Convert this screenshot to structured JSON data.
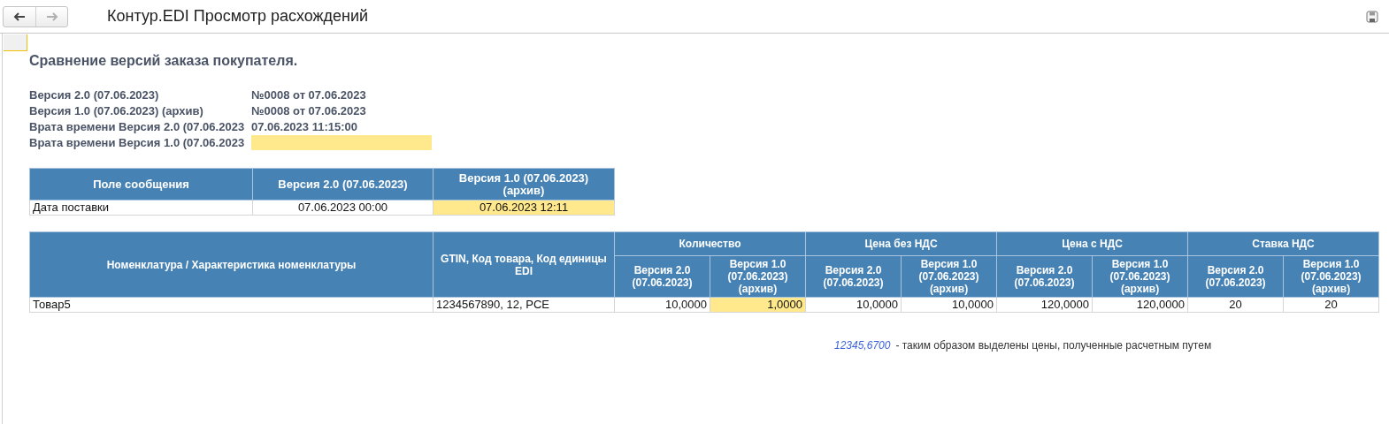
{
  "window": {
    "title": "Контур.EDI Просмотр расхождений",
    "back": {
      "disabled": false
    },
    "forward": {
      "disabled": true
    }
  },
  "report": {
    "heading": "Сравнение версий заказа покупателя.",
    "info": [
      {
        "label": "Версия 2.0 (07.06.2023)",
        "value": "№0008 от 07.06.2023",
        "highlighted": false
      },
      {
        "label": "Версия 1.0 (07.06.2023) (архив)",
        "value": "№0008 от 07.06.2023",
        "highlighted": false
      },
      {
        "label": "Врата времени Версия 2.0 (07.06.2023",
        "value": "07.06.2023 11:15:00",
        "highlighted": false
      },
      {
        "label": "Врата времени Версия 1.0 (07.06.2023",
        "highlighted": true
      }
    ],
    "fields_table": {
      "columns": [
        "Поле сообщения",
        "Версия 2.0 (07.06.2023)",
        "Версия 1.0 (07.06.2023) (архив)"
      ],
      "rows": [
        {
          "cells": [
            {
              "text": "Дата поставки",
              "highlighted": false
            },
            {
              "text": "07.06.2023 00:00",
              "highlighted": false
            },
            {
              "text": "07.06.2023 12:11",
              "highlighted": true
            }
          ]
        }
      ]
    },
    "items_table": {
      "header_rows": [
        [
          {
            "text": "Номенклатура / Характеристика номенклатуры",
            "rowspan": 2
          },
          {
            "text": "GTIN, Код товара, Код единицы EDI",
            "rowspan": 2
          },
          {
            "text": "Количество",
            "colspan": 2
          },
          {
            "text": "Цена без НДС",
            "colspan": 2
          },
          {
            "text": "Цена с НДС",
            "colspan": 2
          },
          {
            "text": "Ставка НДС",
            "colspan": 2
          }
        ],
        [
          {
            "text": "Версия 2.0 (07.06.2023)"
          },
          {
            "text": "Версия 1.0 (07.06.2023) (архив)"
          },
          {
            "text": "Версия 2.0 (07.06.2023)"
          },
          {
            "text": "Версия 1.0 (07.06.2023) (архив)"
          },
          {
            "text": "Версия 2.0 (07.06.2023)"
          },
          {
            "text": "Версия 1.0 (07.06.2023) (архив)"
          },
          {
            "text": "Версия 2.0 (07.06.2023)"
          },
          {
            "text": "Версия 1.0 (07.06.2023) (архив)"
          }
        ]
      ],
      "rows": [
        {
          "cells": [
            {
              "text": "Товар5",
              "highlighted": false
            },
            {
              "text": "1234567890, 12, PCE",
              "highlighted": false
            },
            {
              "text": "10,0000",
              "highlighted": false
            },
            {
              "text": "1,0000",
              "highlighted": true
            },
            {
              "text": "10,0000",
              "highlighted": false
            },
            {
              "text": "10,0000",
              "highlighted": false
            },
            {
              "text": "120,0000",
              "highlighted": false
            },
            {
              "text": "120,0000",
              "highlighted": false
            },
            {
              "text": "20",
              "highlighted": false
            },
            {
              "text": "20",
              "highlighted": false
            }
          ]
        }
      ]
    },
    "legend": {
      "sample": "12345,6700",
      "text": "- таким образом выделены цены, полученные расчетным путем"
    }
  }
}
